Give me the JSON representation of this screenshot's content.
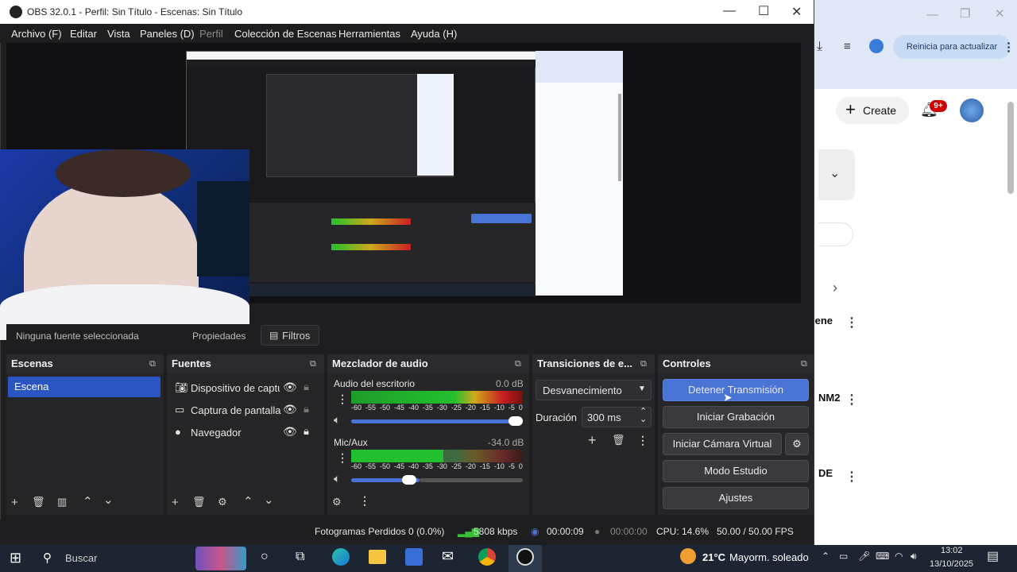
{
  "titlebar": {
    "title": "OBS 32.0.1 - Perfil: Sin Título - Escenas: Sin Título"
  },
  "menu": [
    {
      "label": "Archivo (F)"
    },
    {
      "label": "Editar"
    },
    {
      "label": "Vista"
    },
    {
      "label": "Paneles (D)"
    },
    {
      "label": "Perfil",
      "disabled": true
    },
    {
      "label": "Colección de Escenas"
    },
    {
      "label": "Herramientas"
    },
    {
      "label": "Ayuda (H)"
    }
  ],
  "preview_overlay": {
    "filters_label": "Filtros",
    "no_source": "Ninguna fuente seleccionada",
    "properties": "Propiedades"
  },
  "docks": {
    "scenes": {
      "title": "Escenas",
      "items": [
        "Escena"
      ]
    },
    "sources": {
      "title": "Fuentes",
      "items": [
        "Dispositivo de captu",
        "Captura de pantalla",
        "Navegador"
      ]
    },
    "mixer": {
      "title": "Mezclador de audio",
      "channels": [
        {
          "name": "Audio del escritorio",
          "db": "0.0 dB"
        },
        {
          "name": "Mic/Aux",
          "db": "-34.0 dB"
        }
      ],
      "ticks": [
        "-60",
        "-55",
        "-50",
        "-45",
        "-40",
        "-35",
        "-30",
        "-25",
        "-20",
        "-15",
        "-10",
        "-5",
        "0"
      ]
    },
    "transitions": {
      "title": "Transiciones de e...",
      "selected": "Desvanecimiento",
      "duration_label": "Duración",
      "duration_value": "300 ms"
    },
    "controls": {
      "title": "Controles",
      "buttons": [
        "Detener Transmisión",
        "Iniciar Grabación",
        "Iniciar Cámara Virtual",
        "Modo Estudio",
        "Ajustes"
      ]
    }
  },
  "status": {
    "dropped": "Fotogramas Perdidos 0 (0.0%)",
    "bitrate": "5808 kbps",
    "stream_time": "00:00:09",
    "rec_time": "00:00:00",
    "cpu": "CPU: 14.6%",
    "fps": "50.00 / 50.00 FPS"
  },
  "browser": {
    "update_pill": "Reinicia para actualizar",
    "create": "Create",
    "notif": "9+",
    "row1": "iene",
    "row2": "NM2",
    "row3": "DE"
  },
  "taskbar": {
    "search": "Buscar",
    "weather_temp": "21°C",
    "weather_desc": "Mayorm. soleado",
    "time": "13:02",
    "date": "13/10/2025"
  },
  "colors": {
    "accent": "#4a73d6",
    "bg": "#1e1e20",
    "taskbar": "#1d2532"
  }
}
